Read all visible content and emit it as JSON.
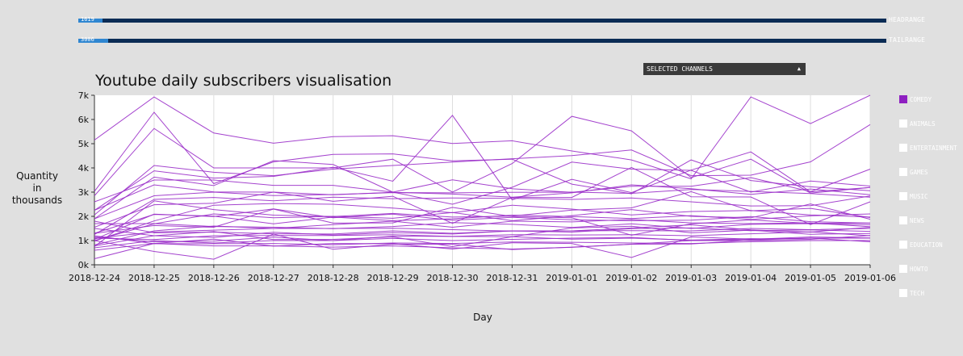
{
  "ranges": [
    {
      "name": "HEADRANGE",
      "value": "1619",
      "fraction": 0.03
    },
    {
      "name": "TAILRANGE",
      "value": "3006",
      "fraction": 0.037
    }
  ],
  "selector": {
    "label": "SELECTED CHANNELS"
  },
  "legend": [
    {
      "label": "COMEDY",
      "checked": true
    },
    {
      "label": "ANIMALS",
      "checked": false
    },
    {
      "label": "ENTERTAINMENT",
      "checked": false
    },
    {
      "label": "GAMES",
      "checked": false
    },
    {
      "label": "MUSIC",
      "checked": false
    },
    {
      "label": "NEWS",
      "checked": false
    },
    {
      "label": "EDUCATION",
      "checked": false
    },
    {
      "label": "HOWTO",
      "checked": false
    },
    {
      "label": "TECH",
      "checked": false
    }
  ],
  "colors": {
    "series": "#9a2fc9",
    "background": "#e0e0e0",
    "plot": "#ffffff",
    "range_track": "#0b2c55",
    "range_handle": "#2f86d1"
  },
  "chart_data": {
    "type": "line",
    "title": "Youtube daily subscribers visualisation",
    "xlabel": "Day",
    "ylabel": "Quantity in thousands",
    "ylim": [
      0,
      7000
    ],
    "yticks": [
      {
        "value": 0,
        "label": "0k"
      },
      {
        "value": 1000,
        "label": "1k"
      },
      {
        "value": 2000,
        "label": "2k"
      },
      {
        "value": 3000,
        "label": "3k"
      },
      {
        "value": 4000,
        "label": "4k"
      },
      {
        "value": 5000,
        "label": "5k"
      },
      {
        "value": 6000,
        "label": "6k"
      },
      {
        "value": 7000,
        "label": "7k"
      }
    ],
    "x": [
      "2018-12-24",
      "2018-12-25",
      "2018-12-26",
      "2018-12-27",
      "2018-12-28",
      "2018-12-29",
      "2018-12-30",
      "2018-12-31",
      "2019-01-01",
      "2019-01-02",
      "2019-01-03",
      "2019-01-04",
      "2019-01-05",
      "2019-01-06"
    ],
    "grid": "vertical",
    "series": [
      {
        "values": [
          5150,
          6930,
          5440,
          5020,
          5290,
          5330,
          5010,
          5120,
          4700,
          4330,
          3550,
          6930,
          5830,
          7000
        ]
      },
      {
        "values": [
          3030,
          6300,
          3350,
          4250,
          4560,
          4580,
          4290,
          4360,
          3330,
          2930,
          4330,
          3480,
          3220,
          3060
        ]
      },
      {
        "values": [
          2850,
          5630,
          4000,
          4000,
          4000,
          4360,
          3000,
          4180,
          6130,
          5530,
          3600,
          4360,
          2960,
          3190
        ]
      },
      {
        "values": [
          2060,
          4100,
          3820,
          3680,
          3950,
          4100,
          4240,
          4380,
          4510,
          4740,
          3680,
          3700,
          4250,
          5790
        ]
      },
      {
        "values": [
          2250,
          3880,
          3580,
          3650,
          4030,
          3450,
          6170,
          2680,
          3530,
          2980,
          3910,
          4660,
          3010,
          3190
        ]
      },
      {
        "values": [
          1900,
          3620,
          3270,
          4300,
          4140,
          3000,
          2500,
          3200,
          4240,
          3950,
          3900,
          3000,
          3460,
          3250
        ]
      },
      {
        "values": [
          2600,
          3500,
          3500,
          3280,
          3280,
          3000,
          3510,
          3140,
          2990,
          3240,
          3240,
          3600,
          3020,
          3950
        ]
      },
      {
        "values": [
          2250,
          3300,
          3010,
          3000,
          2890,
          2990,
          2920,
          2790,
          2970,
          3300,
          3140,
          2910,
          3130,
          2890
        ]
      },
      {
        "values": [
          1900,
          2850,
          3000,
          2860,
          2900,
          2980,
          2970,
          2990,
          3000,
          2950,
          3110,
          3030,
          2940,
          2790
        ]
      },
      {
        "values": [
          1550,
          2480,
          2540,
          3000,
          2620,
          2830,
          1710,
          2780,
          2780,
          4020,
          2810,
          2800,
          1660,
          2600
        ]
      },
      {
        "values": [
          1250,
          2700,
          2780,
          2640,
          2790,
          2730,
          2760,
          2740,
          2700,
          2760,
          2600,
          2430,
          2440,
          2840
        ]
      },
      {
        "values": [
          750,
          2640,
          2280,
          2050,
          1990,
          2120,
          1970,
          2010,
          2260,
          2350,
          3020,
          2230,
          2330,
          1950
        ]
      },
      {
        "values": [
          980,
          1810,
          2460,
          2530,
          2500,
          2340,
          2150,
          2460,
          2300,
          2060,
          2200,
          2240,
          2060,
          1970
        ]
      },
      {
        "values": [
          1000,
          1690,
          2100,
          1940,
          2000,
          1920,
          2160,
          1820,
          2030,
          2280,
          2000,
          1940,
          2510,
          1880
        ]
      },
      {
        "values": [
          1300,
          2080,
          2010,
          1690,
          1970,
          1820,
          1900,
          2050,
          1990,
          1910,
          2030,
          1870,
          2020,
          2100
        ]
      },
      {
        "values": [
          1050,
          2090,
          1990,
          2310,
          1940,
          2090,
          1840,
          1960,
          1860,
          1820,
          1840,
          1990,
          1780,
          1720
        ]
      },
      {
        "values": [
          1300,
          1620,
          1550,
          2300,
          1720,
          1730,
          2370,
          1990,
          1940,
          1220,
          1690,
          1850,
          1710,
          1720
        ]
      },
      {
        "values": [
          820,
          1400,
          1600,
          1500,
          1660,
          1800,
          1550,
          1800,
          1770,
          1870,
          1730,
          1700,
          1730,
          1570
        ]
      },
      {
        "values": [
          1700,
          1700,
          1580,
          1550,
          1490,
          1580,
          1740,
          1670,
          1540,
          1690,
          1500,
          1670,
          1700,
          1650
        ]
      },
      {
        "values": [
          1100,
          1350,
          1430,
          1500,
          1500,
          1510,
          1450,
          1390,
          1400,
          1520,
          1650,
          1440,
          1350,
          1550
        ]
      },
      {
        "values": [
          1800,
          1320,
          1350,
          1280,
          1270,
          1400,
          1300,
          1400,
          1400,
          1410,
          1400,
          1500,
          1450,
          1500
        ]
      },
      {
        "values": [
          1500,
          1200,
          1130,
          1340,
          1230,
          1330,
          1270,
          1400,
          1350,
          1490,
          1520,
          1410,
          1440,
          1380
        ]
      },
      {
        "values": [
          1100,
          1040,
          1200,
          1210,
          1210,
          1240,
          1170,
          1240,
          1230,
          1240,
          1200,
          1280,
          1360,
          1200
        ]
      },
      {
        "values": [
          1150,
          950,
          980,
          1140,
          1000,
          1180,
          1170,
          1160,
          1060,
          1100,
          1020,
          1080,
          1050,
          1210
        ]
      },
      {
        "values": [
          780,
          1200,
          1370,
          1040,
          1050,
          1150,
          750,
          1160,
          1520,
          1590,
          1320,
          1430,
          1260,
          1290
        ]
      },
      {
        "values": [
          700,
          1000,
          900,
          1000,
          1000,
          1090,
          1000,
          1050,
          1100,
          1130,
          1000,
          1050,
          1150,
          1110
        ]
      },
      {
        "values": [
          1200,
          870,
          870,
          880,
          830,
          900,
          880,
          940,
          930,
          900,
          880,
          950,
          1000,
          1000
        ]
      },
      {
        "values": [
          250,
          880,
          1060,
          770,
          880,
          870,
          650,
          910,
          880,
          300,
          1150,
          1060,
          1100,
          950
        ]
      },
      {
        "values": [
          1000,
          550,
          230,
          1270,
          640,
          850,
          850,
          630,
          730,
          850,
          860,
          1020,
          1100,
          1100
        ]
      },
      {
        "values": [
          600,
          880,
          780,
          780,
          730,
          780,
          700,
          650,
          720,
          850,
          1000,
          1000,
          1000,
          1000
        ]
      }
    ]
  }
}
